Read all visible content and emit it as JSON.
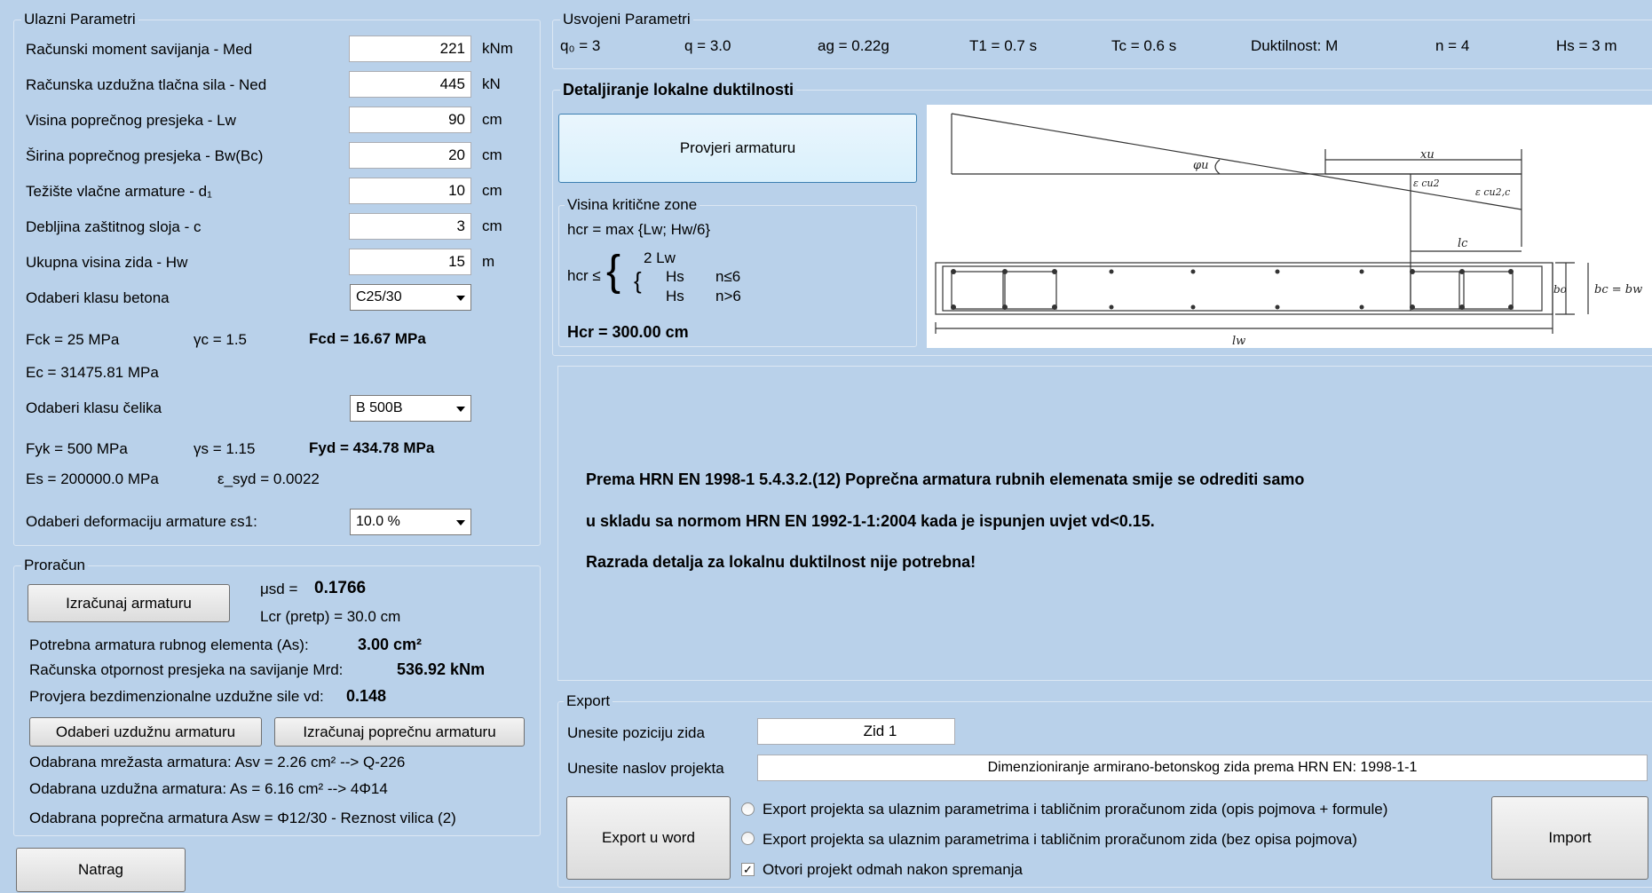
{
  "ulazni": {
    "title": "Ulazni Parametri",
    "rows": [
      {
        "label": "Računski moment savijanja - Med",
        "value": "221",
        "unit": "kNm"
      },
      {
        "label": "Računska uzdužna tlačna sila - Ned",
        "value": "445",
        "unit": "kN"
      },
      {
        "label": "Visina poprečnog presjeka - Lw",
        "value": "90",
        "unit": "cm"
      },
      {
        "label": "Širina poprečnog presjeka - Bw(Bc)",
        "value": "20",
        "unit": "cm"
      },
      {
        "label": "Težište vlačne armature - d₁",
        "value": "10",
        "unit": "cm"
      },
      {
        "label": "Debljina zaštitnog sloja - c",
        "value": "3",
        "unit": "cm"
      },
      {
        "label": "Ukupna visina zida - Hw",
        "value": "15",
        "unit": "m"
      }
    ],
    "beton_label": "Odaberi klasu betona",
    "beton_value": "C25/30",
    "fck": "Fck = 25  MPa",
    "gc": "γc = 1.5",
    "fcd": "Fcd = 16.67 MPa",
    "ec": "Ec = 31475.81 MPa",
    "celik_label": "Odaberi klasu čelika",
    "celik_value": "B 500B",
    "fyk": "Fyk = 500  MPa",
    "gs": "γs = 1.15",
    "fyd": "Fyd = 434.78 MPa",
    "es": "Es = 200000.0 MPa",
    "esyd": "ε_syd = 0.0022",
    "def_label": "Odaberi deformaciju armature εs1:",
    "def_value": "10.0 %"
  },
  "proracun": {
    "title": "Proračun",
    "izracunaj_btn": "Izračunaj armaturu",
    "musd_label": "μsd =",
    "musd_value": "0.1766",
    "lcr": "Lcr (pretp) = 30.0 cm",
    "as_label": "Potrebna armatura rubnog elementa (As):",
    "as_value": "3.00 cm²",
    "mrd_label": "Računska otpornost presjeka na savijanje Mrd:",
    "mrd_value": "536.92 kNm",
    "vd_label": "Provjera bezdimenzionalne uzdužne sile vd:",
    "vd_value": "0.148",
    "uzduzna_btn": "Odaberi uzdužnu armaturu",
    "poprecna_btn": "Izračunaj poprečnu armaturu",
    "mrezasta": "Odabrana mrežasta armatura: Asv = 2.26 cm² --> Q-226",
    "uzduzna": "Odabrana uzdužna armatura: As = 6.16 cm²  --> 4Φ14",
    "poprecna": "Odabrana poprečna armatura Asw = Φ12/30 - Reznost vilica (2)"
  },
  "natrag_btn": "Natrag",
  "usvojeni": {
    "title": "Usvojeni Parametri",
    "items": [
      "q₀ = 3",
      "q = 3.0",
      "ag = 0.22g",
      "T1 = 0.7 s",
      "Tc = 0.6 s",
      "Duktilnost: M",
      "n = 4",
      "Hs = 3 m"
    ]
  },
  "detalj": {
    "title": "Detaljiranje lokalne duktilnosti",
    "provjeri_btn": "Provjeri armaturu",
    "visina_title": "Visina kritične zone",
    "hcr_max": "hcr = max {Lw; Hw/6}",
    "hcr_le": "hcr ≤",
    "two_lw": "2 Lw",
    "hs1": "Hs",
    "cond1": "n≤6",
    "hs2": "Hs",
    "cond2": "n>6",
    "hcr_result": "Hcr = 300.00 cm"
  },
  "diagram": {
    "phi": "φu",
    "xu": "xu",
    "ecu2": "ε cu2",
    "ecu2c": "ε cu2,c",
    "lc": "lc",
    "bo": "bo",
    "bc": "bc = bw",
    "lw": "lw"
  },
  "message": {
    "line1": "Prema HRN EN 1998-1  5.4.3.2.(12) Poprečna armatura rubnih elemenata smije se odrediti samo",
    "line2": "u skladu sa normom HRN EN 1992-1-1:2004 kada je ispunjen uvjet vd<0.15.",
    "line3": "Razrada detalja za lokalnu duktilnost nije potrebna!"
  },
  "export": {
    "title": "Export",
    "pozicija_label": "Unesite poziciju zida",
    "pozicija_value": "Zid 1",
    "naslov_label": "Unesite naslov projekta",
    "naslov_value": "Dimenzioniranje armirano-betonskog zida prema HRN EN: 1998-1-1",
    "export_btn": "Export u word",
    "radio1": "Export projekta sa ulaznim parametrima i tabličnim proračunom zida (opis pojmova + formule)",
    "radio2": "Export projekta sa ulaznim parametrima i tabličnim proračunom zida (bez opisa pojmova)",
    "check": "Otvori projekt odmah nakon spremanja",
    "check_mark": "✓",
    "import_btn": "Import"
  }
}
